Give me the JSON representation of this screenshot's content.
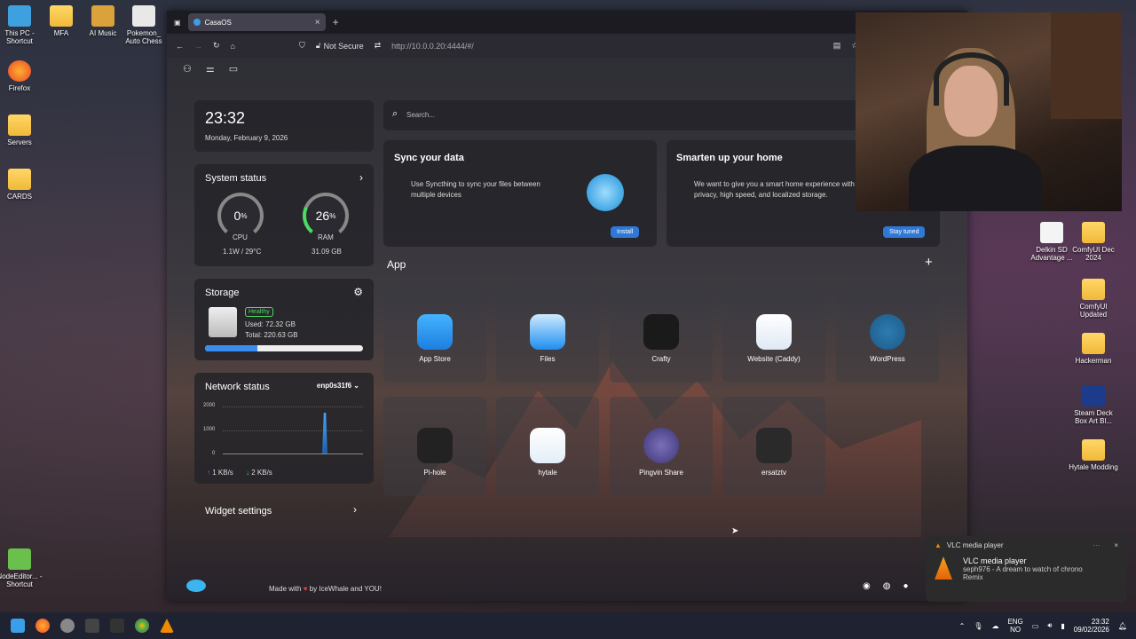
{
  "desktop": {
    "left_icons": [
      {
        "label": "This PC - Shortcut"
      },
      {
        "label": "MFA"
      },
      {
        "label": "AI Music"
      },
      {
        "label": "Pokemon_ Auto Chess"
      },
      {
        "label": "Firefox"
      },
      {
        "label": "Servers"
      },
      {
        "label": "CARDS"
      },
      {
        "label": "NodeEditor... - Shortcut"
      }
    ],
    "right_icons": [
      {
        "label": "Delkin SD Advantage ..."
      },
      {
        "label": "ComfyUI Dec 2024"
      },
      {
        "label": "ComfyUI Updated"
      },
      {
        "label": "Hackerman"
      },
      {
        "label": "Steam Deck Box Art Bl..."
      },
      {
        "label": "Hytale Modding"
      }
    ]
  },
  "browser": {
    "tab_title": "CasaOS",
    "not_secure": "Not Secure",
    "url": "http://10.0.0.20:4444/#/"
  },
  "casaos": {
    "clock": {
      "time": "23:32",
      "date": "Monday, February 9, 2026"
    },
    "system_status": {
      "title": "System status",
      "cpu_value": "0",
      "cpu_unit": "%",
      "cpu_label": "CPU",
      "cpu_sub": "1.1W / 29°C",
      "cpu_percent": 0,
      "ram_value": "26",
      "ram_unit": "%",
      "ram_label": "RAM",
      "ram_sub": "31.09 GB",
      "ram_percent": 26
    },
    "storage": {
      "title": "Storage",
      "badge": "Healthy",
      "used": "Used: 72.32 GB",
      "total": "Total: 220.63 GB",
      "used_fraction": 0.33
    },
    "network": {
      "title": "Network status",
      "iface": "enp0s31f6",
      "y_ticks": [
        "2000",
        "1000",
        "0"
      ],
      "up": "1 KB/s",
      "down": "2 KB/s"
    },
    "widget_settings": "Widget settings",
    "search_placeholder": "Search...",
    "promo1": {
      "title": "Sync your data",
      "text": "Use Syncthing to sync your files between multiple devices",
      "button": "Install"
    },
    "promo2": {
      "title": "Smarten up your home",
      "text": "We want to give you a smart home experience with privacy, high speed, and localized storage.",
      "button": "Stay tuned"
    },
    "apps_title": "App",
    "apps": [
      {
        "label": "App Store"
      },
      {
        "label": "Files"
      },
      {
        "label": "Crafty"
      },
      {
        "label": "Website (Caddy)"
      },
      {
        "label": "WordPress"
      },
      {
        "label": "Pi-hole"
      },
      {
        "label": "hytale"
      },
      {
        "label": "Pingvin Share"
      },
      {
        "label": "ersatztv"
      }
    ],
    "footer": {
      "made_with": "Made with",
      "by": "by IceWhale and YOU!"
    }
  },
  "notification": {
    "app": "VLC media player",
    "title": "VLC media player",
    "line1": "seph976 - A dream to watch of chrono",
    "line2": "Remix"
  },
  "taskbar": {
    "lang1": "ENG",
    "lang2": "NO",
    "time": "23:32",
    "date": "09/02/2026"
  },
  "colors": {
    "accent": "#2f78d6",
    "ram_gauge": "#4cd964",
    "storage_bar": "#3a8df0",
    "healthy": "#4cd964"
  }
}
